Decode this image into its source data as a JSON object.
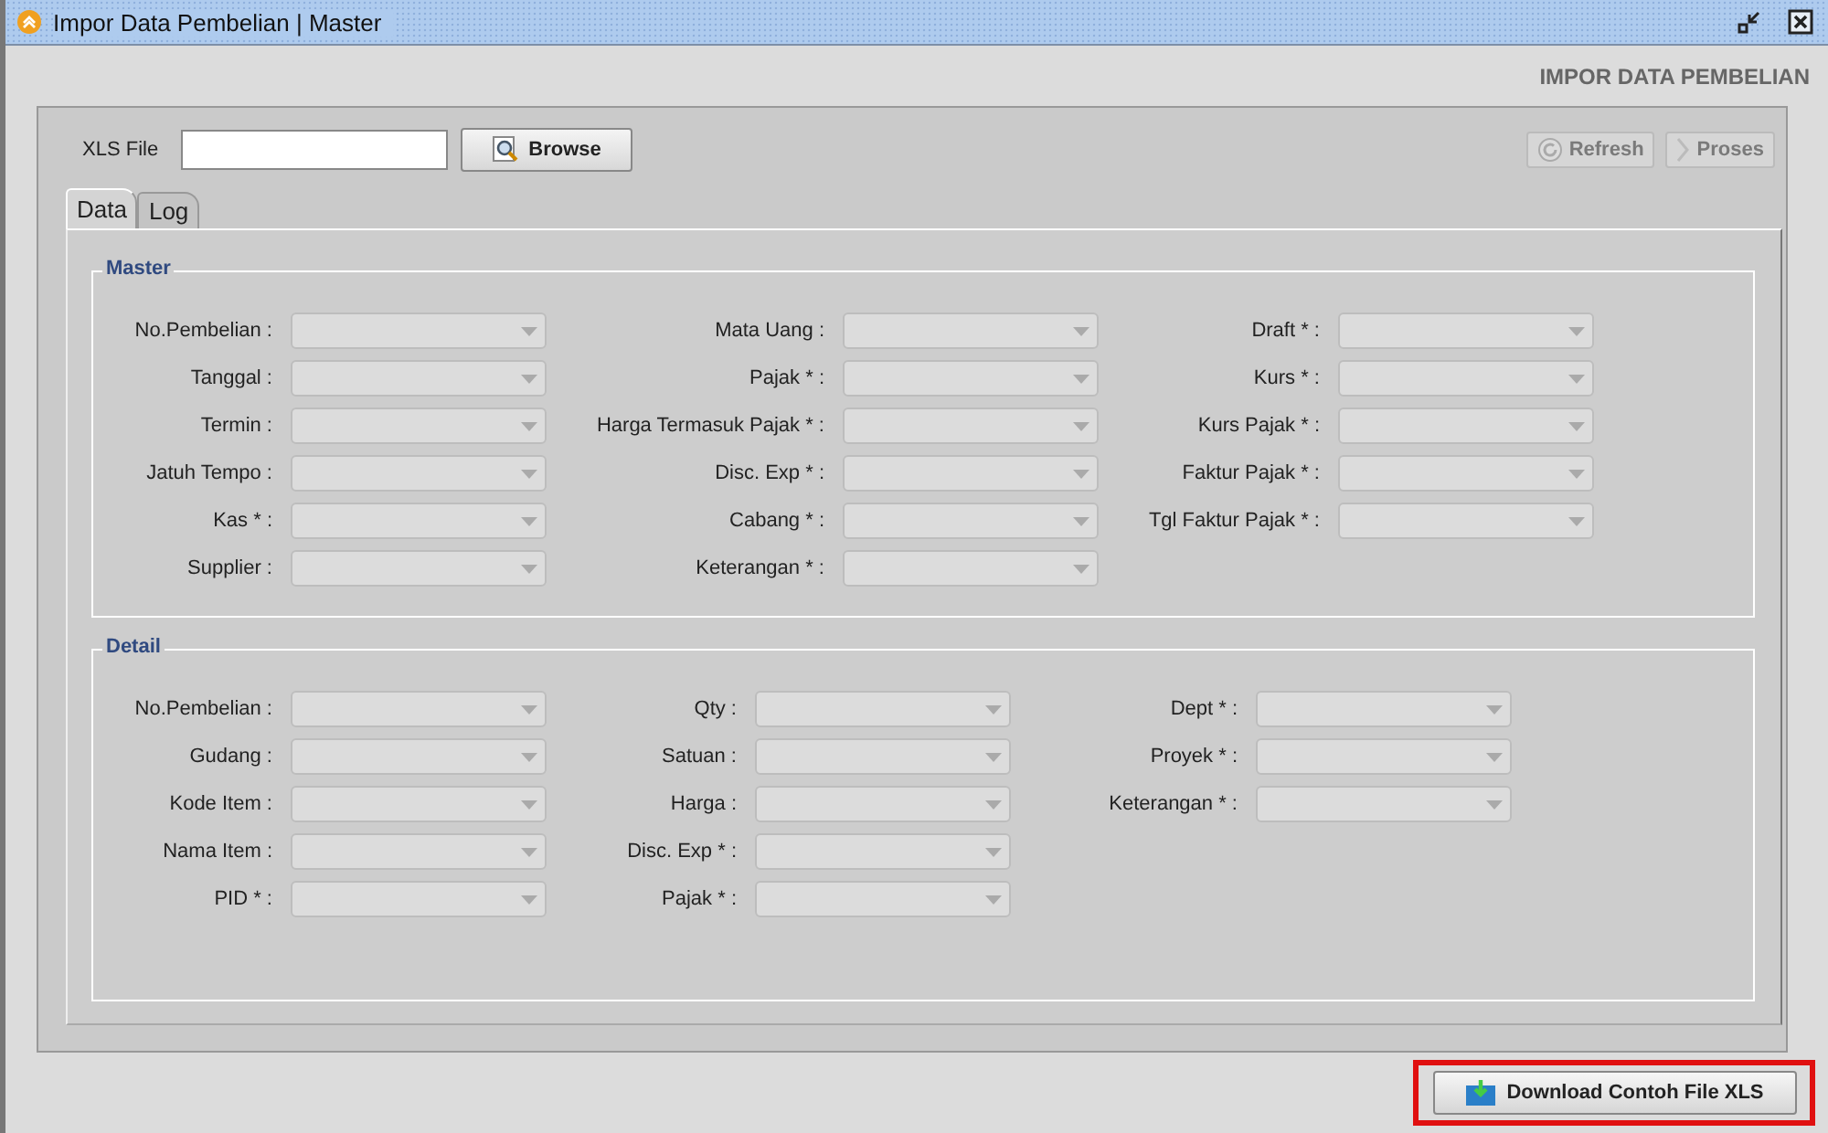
{
  "window": {
    "title": "Impor Data Pembelian | Master"
  },
  "heading": "IMPOR DATA PEMBELIAN",
  "file": {
    "label": "XLS File"
  },
  "browse_button": {
    "label": "Browse",
    "disabled": false
  },
  "actions": [
    {
      "label": "Refresh",
      "kind": "refresh",
      "disabled": true
    },
    {
      "label": "Proses",
      "kind": "proses",
      "disabled": true
    }
  ],
  "tabs": [
    {
      "label": "Data",
      "selected": true
    },
    {
      "label": "Log",
      "selected": false
    }
  ],
  "sections": [
    {
      "title": "Master",
      "columns": [
        [
          {
            "label": "No.Pembelian :",
            "disabled": true
          },
          {
            "label": "Tanggal :",
            "disabled": true
          },
          {
            "label": "Termin :",
            "disabled": true
          },
          {
            "label": "Jatuh Tempo :",
            "disabled": true
          },
          {
            "label": "Kas * :",
            "disabled": true
          },
          {
            "label": "Supplier :",
            "disabled": true
          }
        ],
        [
          {
            "label": "Mata Uang :",
            "disabled": true
          },
          {
            "label": "Pajak * :",
            "disabled": true
          },
          {
            "label": "Harga Termasuk Pajak * :",
            "disabled": true
          },
          {
            "label": "Disc. Exp * :",
            "disabled": true
          },
          {
            "label": "Cabang * :",
            "disabled": true
          },
          {
            "label": "Keterangan * :",
            "disabled": true
          }
        ],
        [
          {
            "label": "Draft * :",
            "disabled": true
          },
          {
            "label": "Kurs * :",
            "disabled": true
          },
          {
            "label": "Kurs Pajak * :",
            "disabled": true
          },
          {
            "label": "Faktur Pajak * :",
            "disabled": true
          },
          {
            "label": "Tgl Faktur Pajak * :",
            "disabled": true
          }
        ]
      ]
    },
    {
      "title": "Detail",
      "columns": [
        [
          {
            "label": "No.Pembelian :",
            "disabled": true
          },
          {
            "label": "Gudang :",
            "disabled": true
          },
          {
            "label": "Kode Item :",
            "disabled": true
          },
          {
            "label": "Nama Item :",
            "disabled": true
          },
          {
            "label": "PID * :",
            "disabled": true
          }
        ],
        [
          {
            "label": "Qty :",
            "disabled": true
          },
          {
            "label": "Satuan :",
            "disabled": true
          },
          {
            "label": "Harga :",
            "disabled": true
          },
          {
            "label": "Disc. Exp * :",
            "disabled": true
          },
          {
            "label": "Pajak * :",
            "disabled": true
          }
        ],
        [
          {
            "label": "Dept * :",
            "disabled": true
          },
          {
            "label": "Proyek * :",
            "disabled": true
          },
          {
            "label": "Keterangan * :",
            "disabled": true
          }
        ]
      ]
    }
  ],
  "download_button": {
    "label": "Download Contoh File XLS",
    "highlighted": true
  }
}
